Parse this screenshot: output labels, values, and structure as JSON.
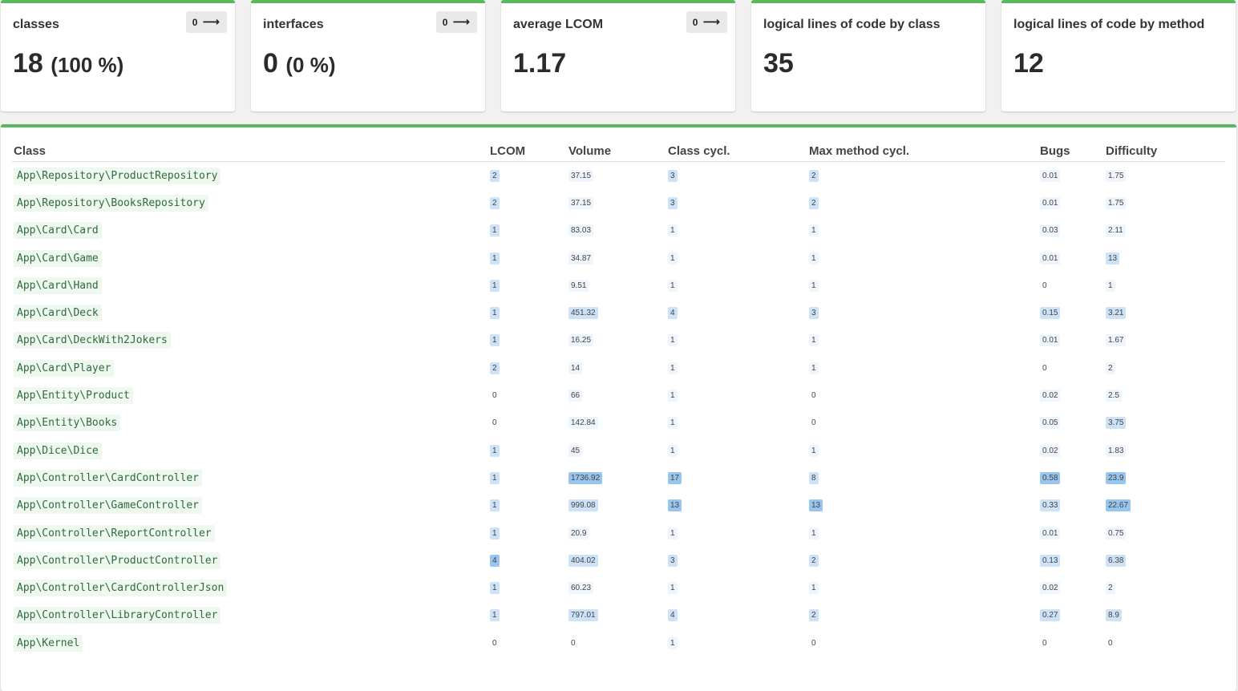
{
  "cards": [
    {
      "title": "classes",
      "value": "18",
      "pct": "(100 %)",
      "trend": "0"
    },
    {
      "title": "interfaces",
      "value": "0",
      "pct": "(0 %)",
      "trend": "0"
    },
    {
      "title": "average LCOM",
      "value": "1.17",
      "pct": "",
      "trend": "0"
    },
    {
      "title": "logical lines of code by class",
      "value": "35",
      "pct": "",
      "trend": ""
    },
    {
      "title": "logical lines of code by method",
      "value": "12",
      "pct": "",
      "trend": ""
    }
  ],
  "table": {
    "headers": [
      "Class",
      "LCOM",
      "Volume",
      "Class cycl.",
      "Max method cycl.",
      "Bugs",
      "Difficulty"
    ],
    "rows": [
      {
        "cls": "App\\Repository\\ProductRepository",
        "lcom": "2",
        "volume": "37.15",
        "ccycl": "3",
        "mcycl": "2",
        "bugs": "0.01",
        "diff": "1.75"
      },
      {
        "cls": "App\\Repository\\BooksRepository",
        "lcom": "2",
        "volume": "37.15",
        "ccycl": "3",
        "mcycl": "2",
        "bugs": "0.01",
        "diff": "1.75"
      },
      {
        "cls": "App\\Card\\Card",
        "lcom": "1",
        "volume": "83.03",
        "ccycl": "1",
        "mcycl": "1",
        "bugs": "0.03",
        "diff": "2.11"
      },
      {
        "cls": "App\\Card\\Game",
        "lcom": "1",
        "volume": "34.87",
        "ccycl": "1",
        "mcycl": "1",
        "bugs": "0.01",
        "diff": "13"
      },
      {
        "cls": "App\\Card\\Hand",
        "lcom": "1",
        "volume": "9.51",
        "ccycl": "1",
        "mcycl": "1",
        "bugs": "0",
        "diff": "1"
      },
      {
        "cls": "App\\Card\\Deck",
        "lcom": "1",
        "volume": "451.32",
        "ccycl": "4",
        "mcycl": "3",
        "bugs": "0.15",
        "diff": "3.21"
      },
      {
        "cls": "App\\Card\\DeckWith2Jokers",
        "lcom": "1",
        "volume": "16.25",
        "ccycl": "1",
        "mcycl": "1",
        "bugs": "0.01",
        "diff": "1.67"
      },
      {
        "cls": "App\\Card\\Player",
        "lcom": "2",
        "volume": "14",
        "ccycl": "1",
        "mcycl": "1",
        "bugs": "0",
        "diff": "2"
      },
      {
        "cls": "App\\Entity\\Product",
        "lcom": "0",
        "volume": "66",
        "ccycl": "1",
        "mcycl": "0",
        "bugs": "0.02",
        "diff": "2.5"
      },
      {
        "cls": "App\\Entity\\Books",
        "lcom": "0",
        "volume": "142.84",
        "ccycl": "1",
        "mcycl": "0",
        "bugs": "0.05",
        "diff": "3.75"
      },
      {
        "cls": "App\\Dice\\Dice",
        "lcom": "1",
        "volume": "45",
        "ccycl": "1",
        "mcycl": "1",
        "bugs": "0.02",
        "diff": "1.83"
      },
      {
        "cls": "App\\Controller\\CardController",
        "lcom": "1",
        "volume": "1736.92",
        "ccycl": "17",
        "mcycl": "8",
        "bugs": "0.58",
        "diff": "23.9"
      },
      {
        "cls": "App\\Controller\\GameController",
        "lcom": "1",
        "volume": "999.08",
        "ccycl": "13",
        "mcycl": "13",
        "bugs": "0.33",
        "diff": "22.67"
      },
      {
        "cls": "App\\Controller\\ReportController",
        "lcom": "1",
        "volume": "20.9",
        "ccycl": "1",
        "mcycl": "1",
        "bugs": "0.01",
        "diff": "0.75"
      },
      {
        "cls": "App\\Controller\\ProductController",
        "lcom": "4",
        "volume": "404.02",
        "ccycl": "3",
        "mcycl": "2",
        "bugs": "0.13",
        "diff": "6.38"
      },
      {
        "cls": "App\\Controller\\CardControllerJson",
        "lcom": "1",
        "volume": "60.23",
        "ccycl": "1",
        "mcycl": "1",
        "bugs": "0.02",
        "diff": "2"
      },
      {
        "cls": "App\\Controller\\LibraryController",
        "lcom": "1",
        "volume": "797.01",
        "ccycl": "4",
        "mcycl": "2",
        "bugs": "0.27",
        "diff": "8.9"
      },
      {
        "cls": "App\\Kernel",
        "lcom": "0",
        "volume": "0",
        "ccycl": "1",
        "mcycl": "0",
        "bugs": "0",
        "diff": "0"
      }
    ]
  },
  "colors": {
    "accent": "#5cb85c",
    "class_text": "#2e6b3e",
    "class_bg": "#eff8ef",
    "heat_low": "#eef5fd",
    "heat_mid": "#cde2f7",
    "heat_high": "#97c5ee"
  },
  "icons": {
    "trend": "arrow-right-icon"
  }
}
